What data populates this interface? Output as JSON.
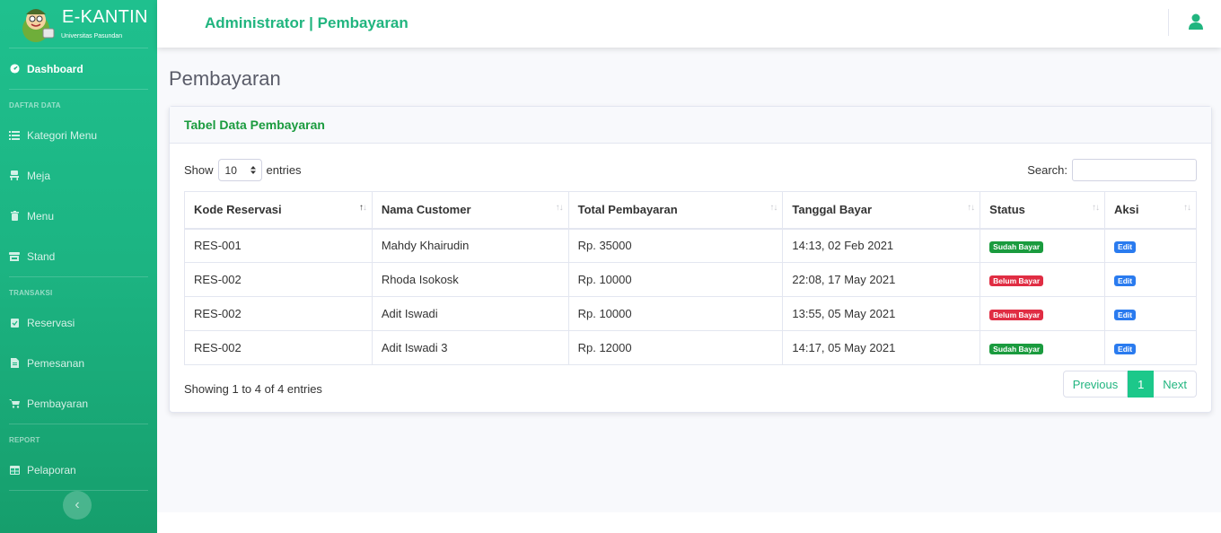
{
  "brand": {
    "title": "E-KANTIN",
    "subtitle": "Universitas Pasundan"
  },
  "topbar": {
    "title": "Administrator | Pembayaran"
  },
  "sidebar": {
    "dashboard": "Dashboard",
    "heading_daftar": "DAFTAR DATA",
    "kategori": "Kategori Menu",
    "meja": "Meja",
    "menu": "Menu",
    "stand": "Stand",
    "heading_transaksi": "TRANSAKSI",
    "reservasi": "Reservasi",
    "pemesanan": "Pemesanan",
    "pembayaran": "Pembayaran",
    "heading_report": "REPORT",
    "pelaporan": "Pelaporan",
    "toggle": "‹"
  },
  "page": {
    "title": "Pembayaran"
  },
  "card": {
    "title": "Tabel Data Pembayaran"
  },
  "controls": {
    "show_label": "Show",
    "show_value": "10",
    "entries_label": "entries",
    "search_label": "Search:",
    "search_value": ""
  },
  "table": {
    "headers": [
      "Kode Reservasi",
      "Nama Customer",
      "Total Pembayaran",
      "Tanggal Bayar",
      "Status",
      "Aksi"
    ],
    "rows": [
      {
        "kode": "RES-001",
        "nama": "Mahdy Khairudin",
        "total": "Rp. 35000",
        "tanggal": "14:13, 02 Feb 2021",
        "status": "Sudah Bayar",
        "aksi": "Edit"
      },
      {
        "kode": "RES-002",
        "nama": "Rhoda Isokosk",
        "total": "Rp. 10000",
        "tanggal": "22:08, 17 May 2021",
        "status": "Belum Bayar",
        "aksi": "Edit"
      },
      {
        "kode": "RES-002",
        "nama": "Adit Iswadi",
        "total": "Rp. 10000",
        "tanggal": "13:55, 05 May 2021",
        "status": "Belum Bayar",
        "aksi": "Edit"
      },
      {
        "kode": "RES-002",
        "nama": "Adit Iswadi 3",
        "total": "Rp. 12000",
        "tanggal": "14:17, 05 May 2021",
        "status": "Sudah Bayar",
        "aksi": "Edit"
      }
    ]
  },
  "footer_info": {
    "showing": "Showing 1 to 4 of 4 entries"
  },
  "pagination": {
    "previous": "Previous",
    "current": "1",
    "next": "Next"
  },
  "colors": {
    "sidebar": "#1cb482",
    "accent": "#1cc88a",
    "success_badge": "#1a9b3e",
    "danger_badge": "#e02d43",
    "edit_badge": "#2a7bef"
  }
}
